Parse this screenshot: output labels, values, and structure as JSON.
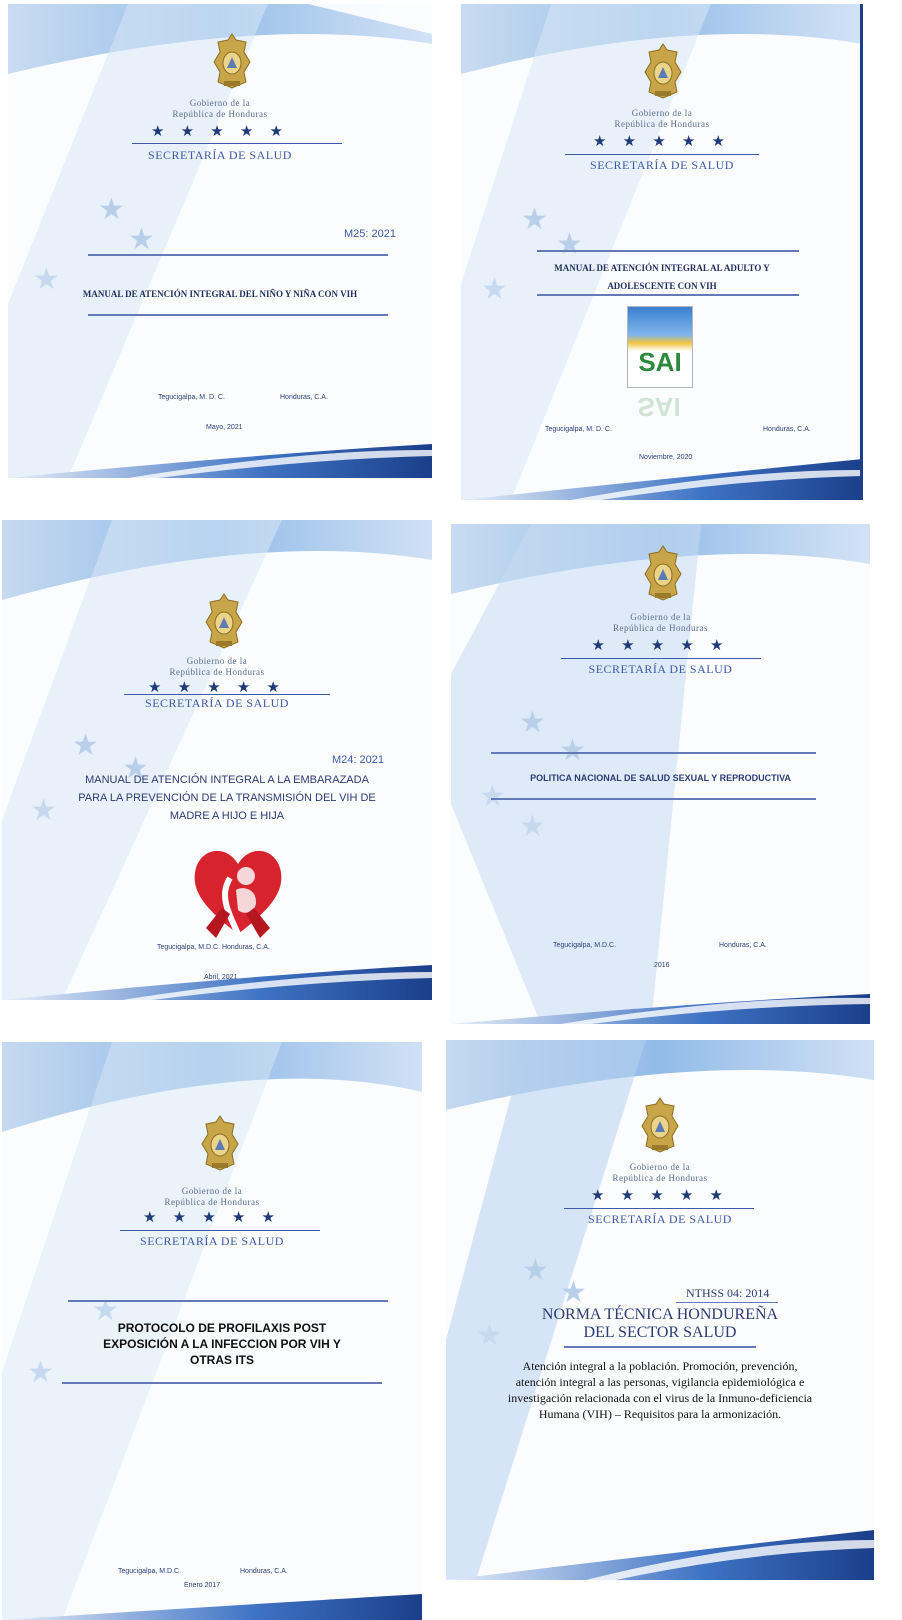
{
  "covers": [
    {
      "gov_line1": "Gobierno de la",
      "gov_line2": "República de Honduras",
      "stars": "★ ★ ★ ★ ★",
      "ministry": "SECRETARÍA DE SALUD",
      "code": "M25: 2021",
      "title": "MANUAL DE ATENCIÓN INTEGRAL DEL NIÑO Y NIÑA CON VIH",
      "place_city": "Tegucigalpa, M. D. C.",
      "place_country": "Honduras, C.A.",
      "date": "Mayo, 2021"
    },
    {
      "gov_line1": "Gobierno de la",
      "gov_line2": "República de Honduras",
      "stars": "★ ★ ★ ★ ★",
      "ministry": "SECRETARÍA DE SALUD",
      "title_line1": "MANUAL DE ATENCIÓN INTEGRAL AL ADULTO Y",
      "title_line2": "ADOLESCENTE CON VIH",
      "logo_text": "SAI",
      "place_city": "Tegucigalpa, M. D. C.",
      "place_country": "Honduras, C.A.",
      "date": "Noviembre, 2020"
    },
    {
      "gov_line1": "Gobierno de la",
      "gov_line2": "República de Honduras",
      "stars": "★ ★ ★ ★ ★",
      "ministry": "SECRETARÍA DE SALUD",
      "code": "M24: 2021",
      "title_line1": "MANUAL DE ATENCIÓN INTEGRAL A LA EMBARAZADA",
      "title_line2": "PARA LA PREVENCIÓN DE LA TRANSMISIÓN DEL VIH DE",
      "title_line3": "MADRE A HIJO E HIJA",
      "place": "Tegucigalpa, M.D.C. Honduras, C.A.",
      "date": "Abril, 2021"
    },
    {
      "gov_line1": "Gobierno de la",
      "gov_line2": "República de Honduras",
      "stars": "★ ★ ★ ★ ★",
      "ministry": "SECRETARÍA DE SALUD",
      "title": "POLITICA NACIONAL DE SALUD SEXUAL Y REPRODUCTIVA",
      "place_city": "Tegucigalpa, M.D.C.",
      "place_country": "Honduras, C.A.",
      "date": "2016"
    },
    {
      "gov_line1": "Gobierno de la",
      "gov_line2": "República de Honduras",
      "stars": "★ ★ ★ ★ ★",
      "ministry": "SECRETARÍA DE SALUD",
      "title_line1": "PROTOCOLO DE PROFILAXIS POST",
      "title_line2": "EXPOSICIÓN A LA INFECCION POR VIH Y",
      "title_line3": "OTRAS ITS",
      "place_city": "Tegucigalpa, M.D.C.",
      "place_country": "Honduras, C.A.",
      "date": "Enero 2017"
    },
    {
      "gov_line1": "Gobierno de la",
      "gov_line2": "República de Honduras",
      "stars": "★ ★ ★ ★ ★",
      "ministry": "SECRETARÍA DE SALUD",
      "code": "NTHSS 04: 2014",
      "title_line1": "NORMA TÉCNICA HONDUREÑA",
      "title_line2": "DEL SECTOR SALUD",
      "desc_line1": "Atención integral a la población. Promoción, prevención,",
      "desc_line2": "atención integral a las personas, vigilancia epidemiológica e",
      "desc_line3": "investigación relacionada con el virus de la Inmuno-deficiencia",
      "desc_line4": "Humana (VIH) – Requisitos para la armonización."
    }
  ]
}
